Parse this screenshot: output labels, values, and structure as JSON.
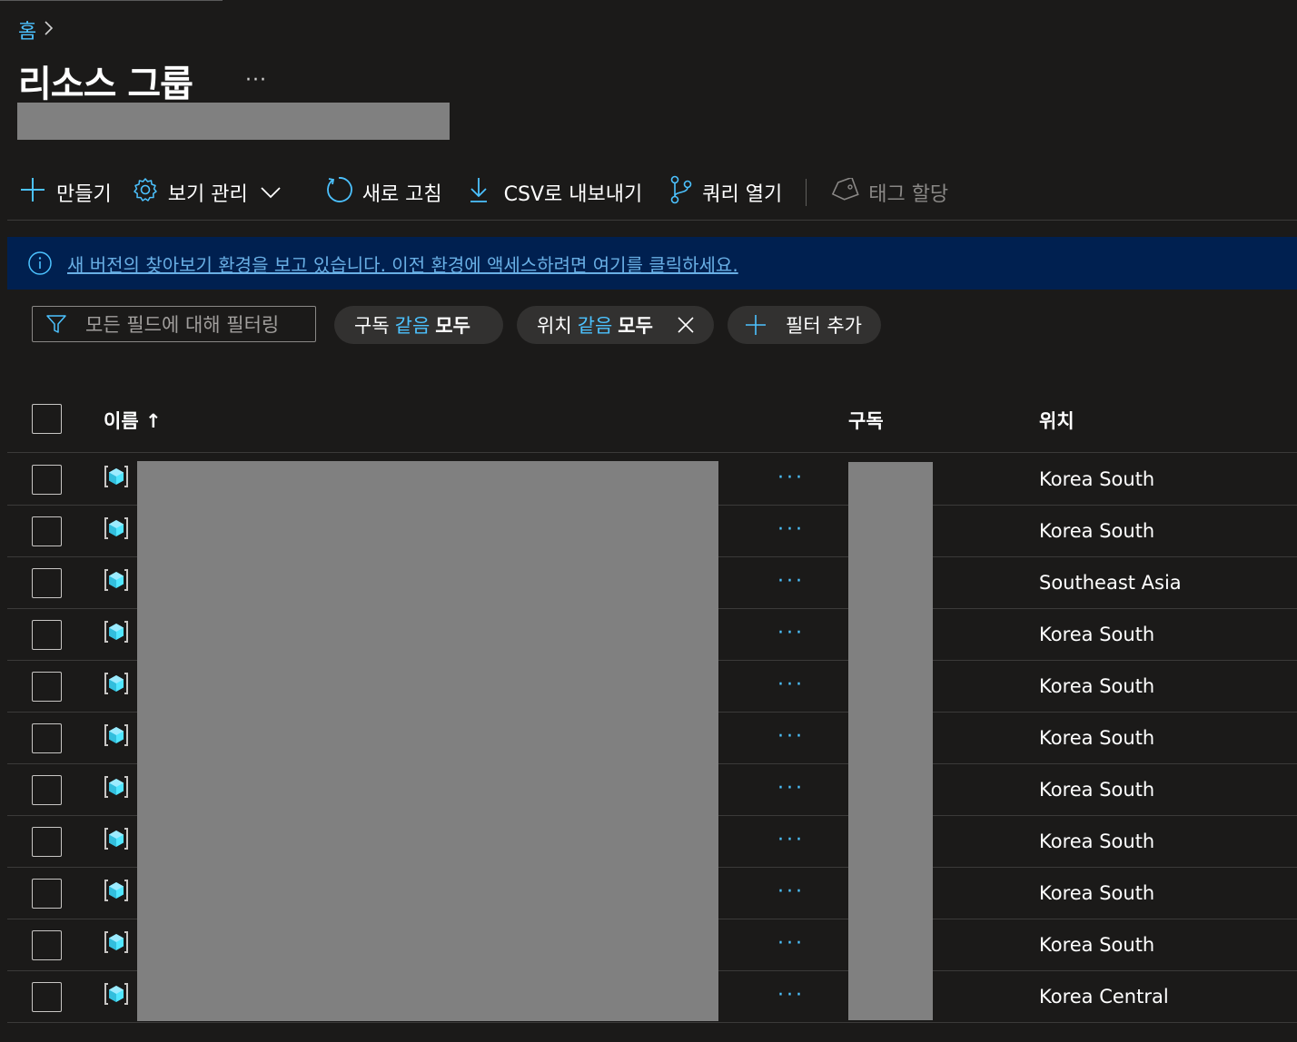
{
  "breadcrumb": {
    "home": "홈"
  },
  "page": {
    "title": "리소스 그룹",
    "more": "···"
  },
  "toolbar": {
    "create": "만들기",
    "manage_view": "보기 관리",
    "refresh": "새로 고침",
    "export_csv": "CSV로 내보내기",
    "open_query": "쿼리 열기",
    "assign_tags": "태그 할당"
  },
  "banner": {
    "text": "새 버전의 찾아보기 환경을 보고 있습니다. 이전 환경에 액세스하려면 여기를 클릭하세요."
  },
  "filters": {
    "search_placeholder": "모든 필드에 대해 필터링",
    "subscription": {
      "field": "구독",
      "op": "같음",
      "value": "모두"
    },
    "location": {
      "field": "위치",
      "op": "같음",
      "value": "모두"
    },
    "add_filter": "필터 추가"
  },
  "table": {
    "headers": {
      "name": "이름 ↑",
      "subscription": "구독",
      "location": "위치"
    },
    "row_more": "···",
    "rows": [
      {
        "location": "Korea South"
      },
      {
        "location": "Korea South"
      },
      {
        "location": "Southeast Asia"
      },
      {
        "location": "Korea South"
      },
      {
        "location": "Korea South"
      },
      {
        "location": "Korea South"
      },
      {
        "location": "Korea South"
      },
      {
        "location": "Korea South"
      },
      {
        "location": "Korea South"
      },
      {
        "location": "Korea South"
      },
      {
        "location": "Korea Central"
      }
    ]
  },
  "colors": {
    "accent": "#4cc2ff",
    "banner_bg": "#002050",
    "background": "#1b1a19"
  },
  "icons": [
    "chevron-right-icon",
    "plus-icon",
    "gear-icon",
    "chevron-down-icon",
    "refresh-icon",
    "download-icon",
    "query-icon",
    "tag-icon",
    "info-icon",
    "filter-icon",
    "close-icon",
    "resource-group-icon"
  ]
}
